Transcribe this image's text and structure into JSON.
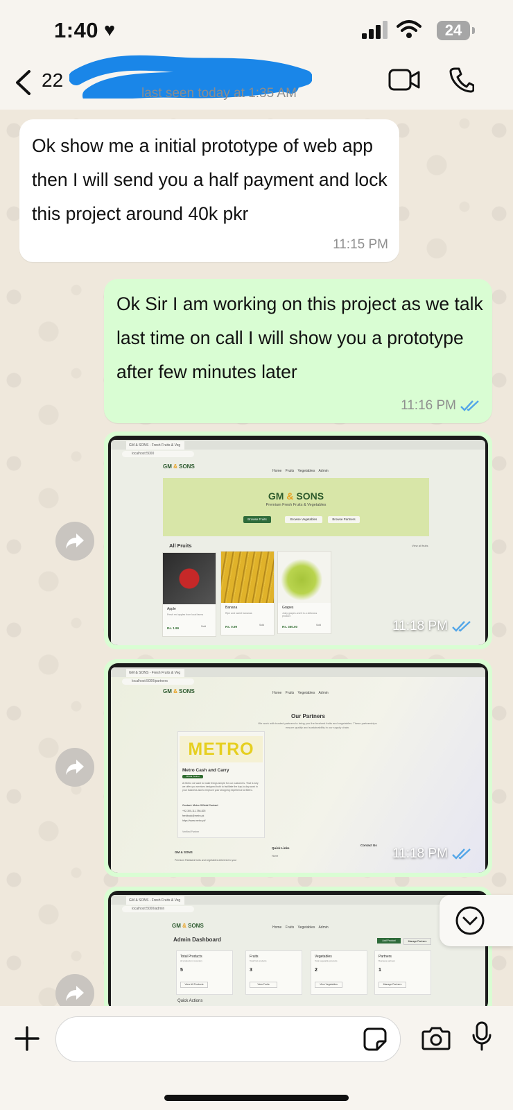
{
  "status_bar": {
    "time": "1:40",
    "battery": "24"
  },
  "header": {
    "unread_count": "22",
    "last_seen": "last seen today at 1:35 AM"
  },
  "messages": {
    "incoming_1": {
      "text": "Ok show me a initial prototype of web app then I will send you a half payment and lock this project around 40k pkr",
      "time": "11:15 PM"
    },
    "outgoing_1": {
      "text": "Ok Sir I am working on this project as we talk last time on call I will show you a prototype after few minutes later",
      "time": "11:16 PM"
    },
    "image_1": {
      "time": "11:18 PM"
    },
    "image_2": {
      "time": "11:18 PM"
    }
  },
  "screenshot_1": {
    "tab_title": "GM & SONS - Fresh Fruits & Veg",
    "url": "localhost:5000",
    "logo": "GM & SONS",
    "nav_links": "Home Fruits Vegetables Admin",
    "hero_title": "GM & SONS",
    "hero_subtitle": "Premium Fresh Fruits & Vegetables",
    "buttons": [
      "Browse Fruits",
      "Browse Vegetables",
      "Browse Partners"
    ],
    "section": "All Fruits",
    "view_all": "View all fruits",
    "products": [
      {
        "name": "Apple",
        "desc": "Fresh red apples from local farms",
        "price": "Rs. 1.99",
        "action": "Sold"
      },
      {
        "name": "Banana",
        "desc": "Ripe and sweet bananas",
        "price": "Rs. 0.99",
        "action": "Sold"
      },
      {
        "name": "Grapes",
        "desc": "Juicy grapes and it is a delicious product",
        "price": "Rs. 350.00",
        "action": "Sold"
      }
    ]
  },
  "screenshot_2": {
    "url": "localhost:5000/partners",
    "logo": "GM & SONS",
    "title": "Our Partners",
    "subtitle": "We work with trusted partners to bring you the freshest fruits and vegetables. These partnerships ensure quality and sustainability in our supply chain.",
    "partner_logo": "METRO",
    "partner_name": "Metro Cash and Carry",
    "partner_badge": "Official Partner",
    "partner_text": "At Metro we want to make things simple for our customers. That is why we offer you services designed both to facilitate the day-to-day work in your business and to improve your shopping experience at Metro.",
    "contact_title": "Contact: Metro Official Contact",
    "contact_phone": "+92-300-111-786-825",
    "contact_email": "feedback@metro.pk",
    "contact_web": "https://www.metro.pk/",
    "verified": "Verified Partner",
    "footer_brand": "GM & SONS",
    "footer_links": "Quick Links",
    "footer_contact": "Contact Us",
    "footer_tagline": "Premium Pakistani fruits and vegetables delivered to your",
    "footer_home": "Home"
  },
  "screenshot_3": {
    "url": "localhost:5000/admin",
    "logo": "GM & SONS",
    "title": "Admin Dashboard",
    "add_product": "Add Product",
    "manage_partners": "Manage Partners",
    "quick_actions": "Quick Actions",
    "stats": [
      {
        "label": "Total Products",
        "small": "All products in inventory",
        "value": "5",
        "btn": "View All Products"
      },
      {
        "label": "Fruits",
        "small": "Total fruit products",
        "value": "3",
        "btn": "View Fruits"
      },
      {
        "label": "Vegetables",
        "small": "Total vegetable products",
        "value": "2",
        "btn": "View Vegetables"
      },
      {
        "label": "Partners",
        "small": "Business partners",
        "value": "1",
        "btn": "Manage Partners"
      }
    ]
  },
  "colors": {
    "incoming_bubble": "#ffffff",
    "outgoing_bubble": "#d9fdd3",
    "read_ticks": "#53a6e8",
    "chat_background": "#efe8dc"
  }
}
